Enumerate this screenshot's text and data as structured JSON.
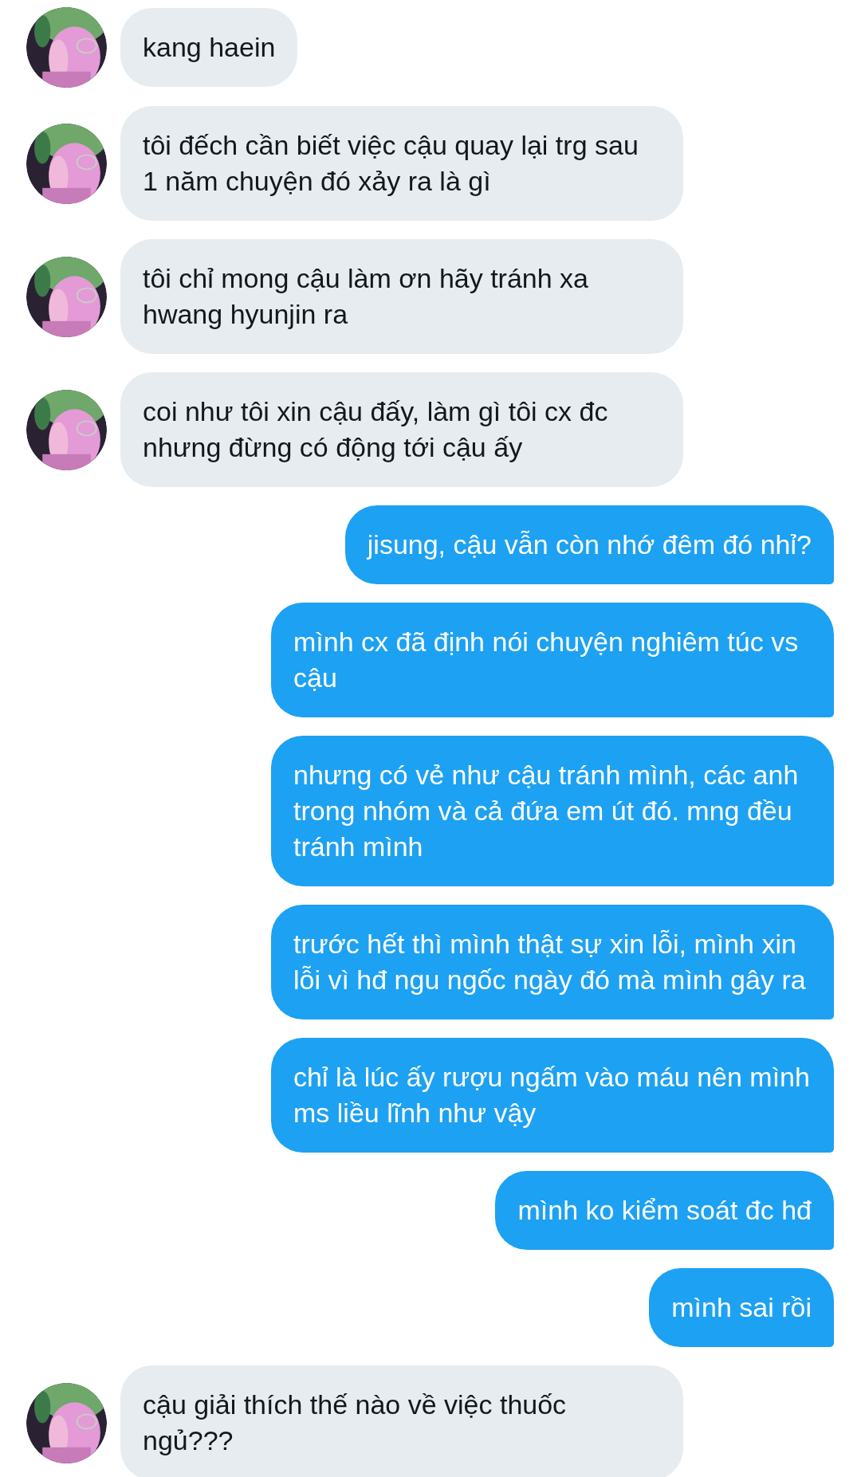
{
  "messages": [
    {
      "kind": "received",
      "text": "kang haein"
    },
    {
      "kind": "received",
      "text": "tôi đếch cần biết việc cậu quay lại trg sau 1 năm chuyện đó xảy ra là gì"
    },
    {
      "kind": "received",
      "text": "tôi chỉ mong cậu làm ơn hãy tránh xa hwang hyunjin ra"
    },
    {
      "kind": "received",
      "text": "coi như tôi xin cậu đấy, làm gì tôi cx đc nhưng đừng có động tới cậu ấy"
    },
    {
      "kind": "sent",
      "text": "jisung, cậu vẫn còn nhớ đêm đó nhỉ?"
    },
    {
      "kind": "sent",
      "text": "mình cx đã định nói chuyện nghiêm túc vs cậu"
    },
    {
      "kind": "sent",
      "text": "nhưng có vẻ như cậu tránh mình, các anh trong nhóm và cả đứa em út đó. mng đều tránh mình"
    },
    {
      "kind": "sent",
      "text": "trước hết thì mình thật sự xin lỗi, mình xin lỗi vì hđ ngu ngốc ngày đó mà mình gây ra"
    },
    {
      "kind": "sent",
      "text": "chỉ là lúc ấy rượu ngấm vào máu nên mình ms liều lĩnh như vậy"
    },
    {
      "kind": "sent",
      "text": "mình ko kiểm soát đc hđ"
    },
    {
      "kind": "sent",
      "text": "mình sai rồi"
    },
    {
      "kind": "received",
      "text": "cậu giải thích thế nào về việc thuốc ngủ???"
    }
  ]
}
